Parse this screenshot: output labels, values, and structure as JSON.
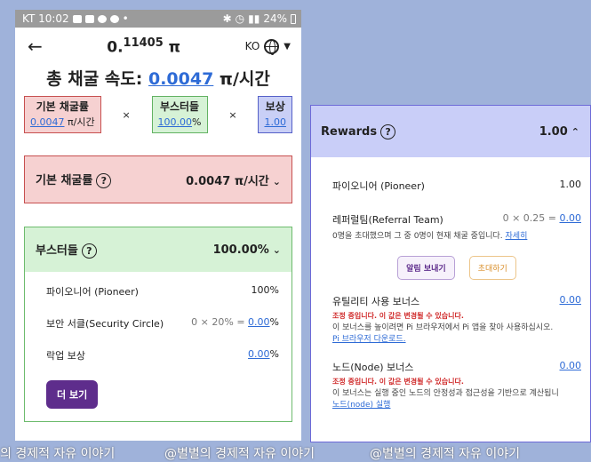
{
  "status": {
    "carrier_time": "KT 10:02",
    "dot": "•",
    "battery": "24%"
  },
  "header": {
    "balance_main": "0.",
    "balance_sup": "11405",
    "currency": " π",
    "lang": "KO"
  },
  "speed": {
    "label": "총 채굴 속도: ",
    "value": "0.0047",
    "unit": " π/시간"
  },
  "factors": {
    "base": {
      "label": "기본 채굴률",
      "value": "0.0047",
      "unit": " π/시간"
    },
    "times": "×",
    "boosters": {
      "label": "부스터들",
      "value": "100.00",
      "unit": "%"
    },
    "reward": {
      "label": "보상",
      "value": "1.00"
    }
  },
  "base_panel": {
    "title": "기본 채굴률",
    "value": "0.0047 π/시간"
  },
  "booster_panel": {
    "title": "부스터들",
    "value": "100.00%",
    "rows": [
      {
        "label": "파이오니어 (Pioneer)",
        "value": "100%"
      },
      {
        "label": "보안 서클(Security Circle)",
        "formula": "0 × 20% = ",
        "value": "0.00",
        "unit": "%"
      },
      {
        "label": "락업 보상",
        "value": "0.00",
        "unit": "%"
      }
    ],
    "more_button": "더 보기"
  },
  "rewards_panel": {
    "title": "Rewards",
    "value": "1.00",
    "pioneer": {
      "label": "파이오니어 (Pioneer)",
      "value": "1.00"
    },
    "referral": {
      "label": "레퍼럴팀(Referral Team)",
      "formula": "0 × 0.25 = ",
      "value": "0.00",
      "desc": "0명을 초대했으며 그 중 0명이 현재 채굴 중입니다. ",
      "detail_link": "자세히",
      "notify_button": "알림 보내기",
      "invite_button": "초대하기"
    },
    "utility": {
      "label": "유틸리티 사용 보너스",
      "value": "0.00",
      "warning": "조정 중입니다. 이 값은 변경될 수 있습니다.",
      "desc": "이 보너스를 높이려면 Pi 브라우저에서 Pi 앱을 찾아 사용하십시오.",
      "link": "Pi 브라우저 다운로드."
    },
    "node": {
      "label": "노드(Node) 보너스",
      "value": "0.00",
      "warning": "조정 중입니다. 이 값은 변경될 수 있습니다.",
      "desc": "이 보너스는 실행 중인 노드의 안정성과 접근성을 기반으로 계산됩니",
      "link": "노드(node) 실행"
    }
  },
  "watermark": {
    "a": "의 경제적 자유 이야기",
    "b": "@별별의 경제적 자유 이야기",
    "c": "@별별의 경제적 자유 이야기"
  }
}
